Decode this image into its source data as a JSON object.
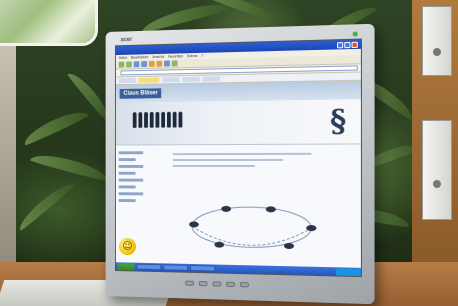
{
  "monitor": {
    "brand": "acer"
  },
  "browser": {
    "menu": [
      "Datei",
      "Bearbeiten",
      "Ansicht",
      "Favoriten",
      "Extras",
      "?"
    ]
  },
  "website": {
    "name": "Claus Bläser",
    "section_mark": "§"
  },
  "desktop_icon": {
    "name": "smiley-face-icon",
    "glyph": "☺"
  }
}
